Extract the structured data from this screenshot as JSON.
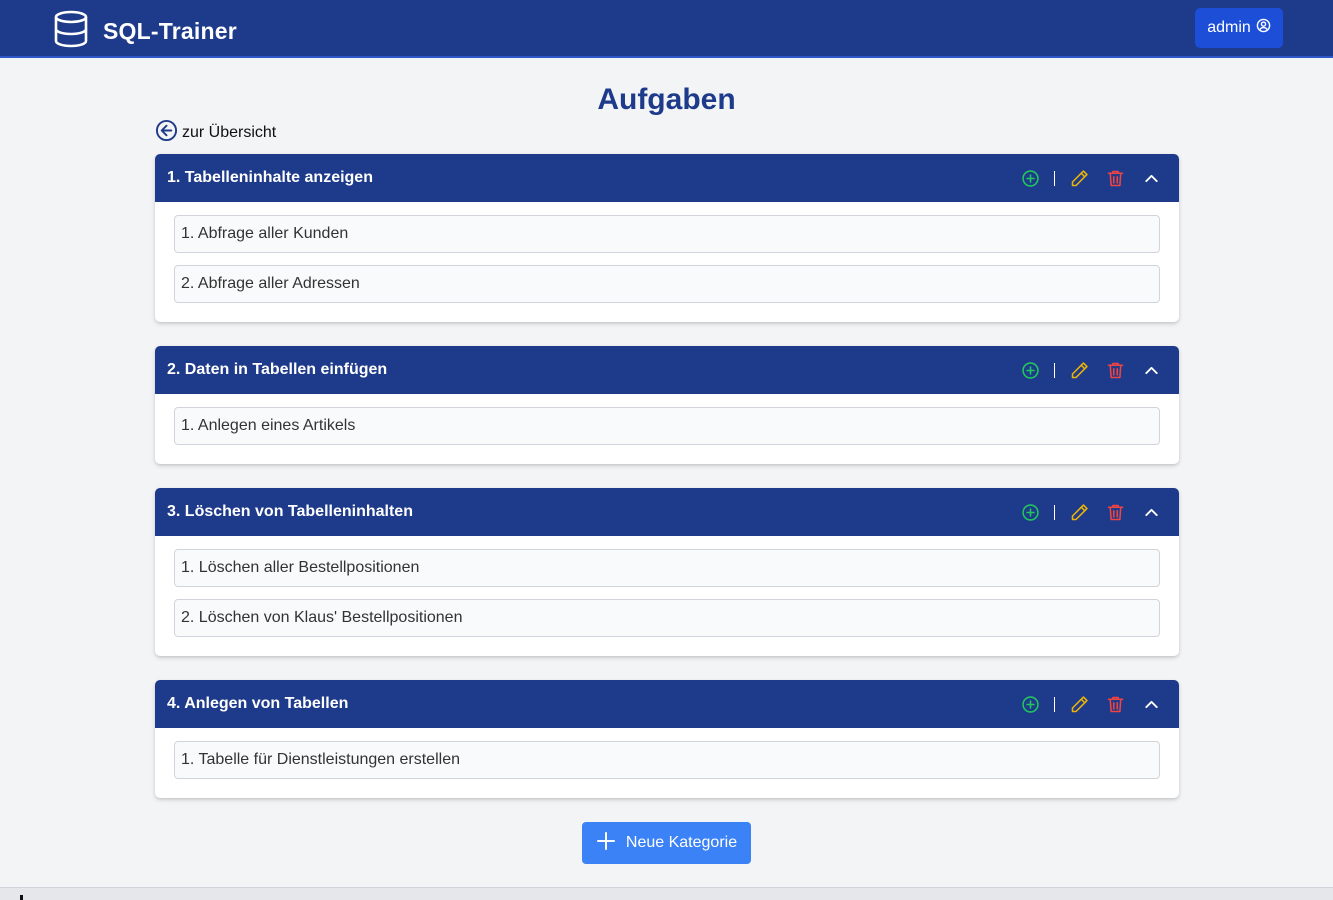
{
  "header": {
    "app_title": "SQL-Trainer",
    "logo_icon": "database-icon",
    "user_label": "admin",
    "user_icon": "user-circle-icon"
  },
  "page": {
    "title": "Aufgaben",
    "back_label": "zur Übersicht"
  },
  "categories": [
    {
      "title": "1. Tabelleninhalte anzeigen",
      "tasks": [
        "1. Abfrage aller Kunden",
        "2. Abfrage aller Adressen"
      ]
    },
    {
      "title": "2. Daten in Tabellen einfügen",
      "tasks": [
        "1. Anlegen eines Artikels"
      ]
    },
    {
      "title": "3. Löschen von Tabelleninhalten",
      "tasks": [
        "1. Löschen aller Bestellpositionen",
        "2. Löschen von Klaus' Bestellpositionen"
      ]
    },
    {
      "title": "4. Anlegen von Tabellen",
      "tasks": [
        "1. Tabelle für Dienstleistungen erstellen"
      ]
    }
  ],
  "actions": {
    "new_category_label": "Neue Kategorie"
  },
  "colors": {
    "header_bg": "#1e3a8a",
    "add_icon": "#22c55e",
    "edit_icon": "#eab308",
    "delete_icon": "#ef4444",
    "primary_button": "#3b82f6"
  }
}
